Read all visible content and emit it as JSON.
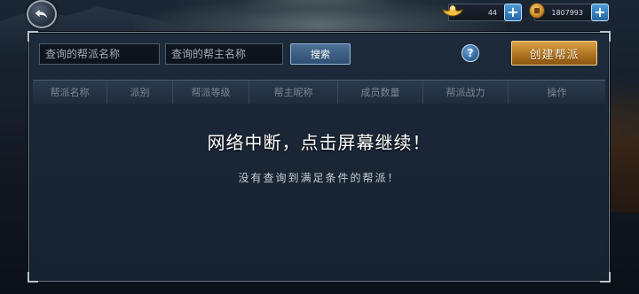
{
  "top_bar": {
    "back_icon": "back-arrow-icon",
    "gold": {
      "icon": "gold-ingot-icon",
      "amount": "44",
      "add_label": "+"
    },
    "coin": {
      "icon": "copper-coin-icon",
      "amount": "1807993",
      "add_label": "+"
    }
  },
  "search": {
    "guild_name_placeholder": "查询的帮派名称",
    "leader_name_placeholder": "查询的帮主名称",
    "search_label": "搜索"
  },
  "help_label": "?",
  "create_label": "创建帮派",
  "columns": [
    {
      "label": "帮派名称"
    },
    {
      "label": "派别"
    },
    {
      "label": "帮派等级"
    },
    {
      "label": "帮主昵称"
    },
    {
      "label": "成员数量"
    },
    {
      "label": "帮派战力"
    },
    {
      "label": "操作"
    }
  ],
  "network_message": "网络中断，点击屏幕继续！",
  "empty_message": "没有查询到满足条件的帮派！",
  "colors": {
    "accent_gold": "#b07420",
    "accent_blue": "#2f4f72",
    "panel_bg": "#17222f"
  }
}
